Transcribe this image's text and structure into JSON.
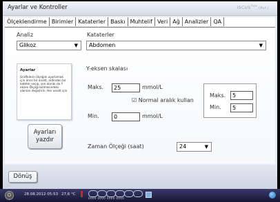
{
  "window": {
    "title": "Ayarlar ve Kontroller",
    "brand": "ISCUS",
    "brand_sup": "flex",
    "brand_suffix": "(Ref.)"
  },
  "tabs": [
    {
      "label": "Ölçeklendirme",
      "active": true
    },
    {
      "label": "Birimler",
      "active": false
    },
    {
      "label": "Kataterler",
      "active": false
    },
    {
      "label": "Baskı",
      "active": false
    },
    {
      "label": "Muhtelif",
      "active": false
    },
    {
      "label": "Veri",
      "active": false
    },
    {
      "label": "Ağ",
      "active": false
    },
    {
      "label": "Analizler",
      "active": false
    },
    {
      "label": "QA",
      "active": false
    }
  ],
  "settings": {
    "analysis_label": "Analiz",
    "analysis_value": "Glikoz",
    "catheters_label": "Kataterler",
    "catheters_value": "Abdomen",
    "help_title": "Ayarlar",
    "help_text": "Grafiklerin ölçeğini ayarlamak için önce bir analit, ardından bir kateter seçip, son olarak da Y eksen Ölçeği bölmesindeki alanları değiştirin. Her analit için",
    "print_label_line1": "Ayarları",
    "print_label_line2": "yazdır",
    "y_scale_label": "Y-eksen skalası",
    "max_label": "Maks.",
    "max_value": "25",
    "max_unit": "mmol/L",
    "normal_range_label": "Normal aralık kullan",
    "normal_range_checked": true,
    "min_label": "Min.",
    "min_value": "0",
    "min_unit": "mmol/L",
    "normal_max_label": "Maks.",
    "normal_max_value": "5",
    "normal_min_label": "Min.",
    "normal_min_value": "5",
    "time_scale_label": "Zaman Ölçeği (saat)",
    "time_scale_value": "24"
  },
  "footer": {
    "back_label": "Dönüş"
  },
  "statusbar": {
    "datetime": "28.08.2012 05:53",
    "temperature": "27,6 °C",
    "slot_digits": "0000 0000 0000 0000"
  }
}
